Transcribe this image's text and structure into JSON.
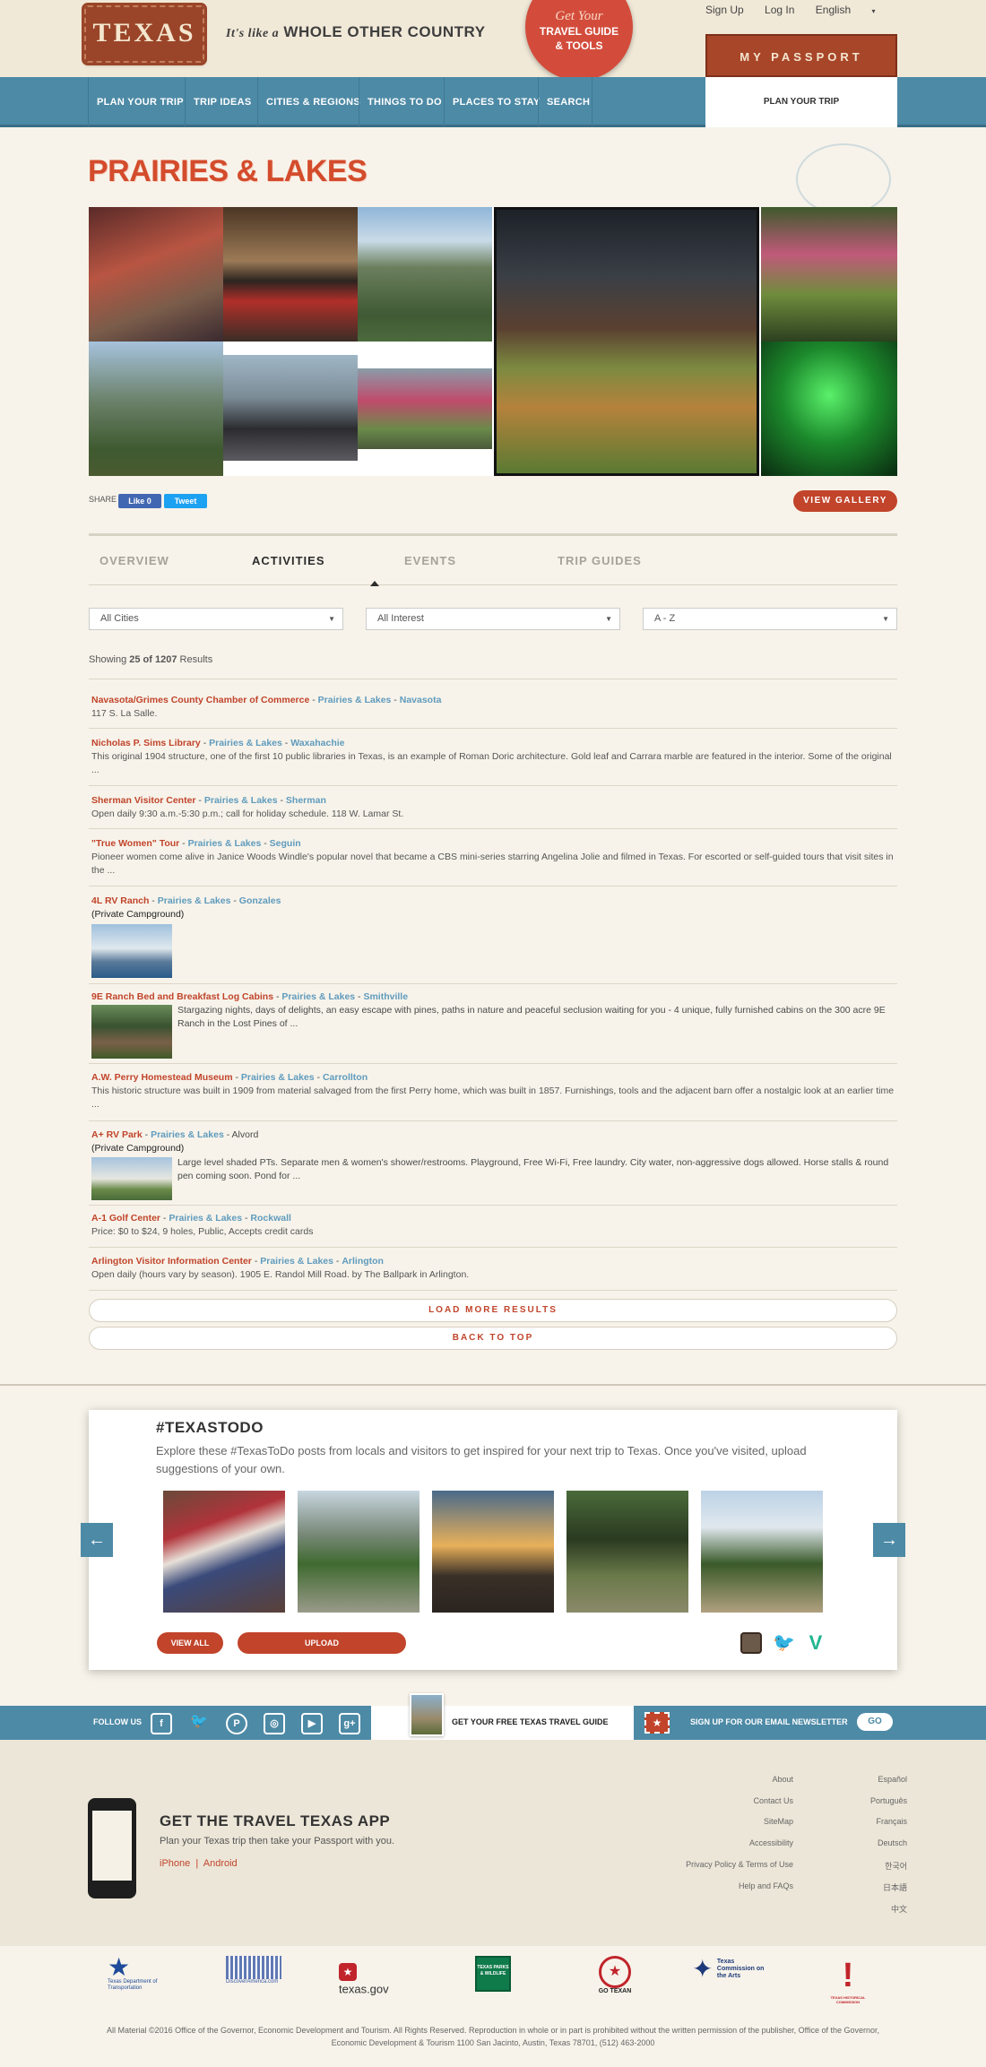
{
  "header": {
    "logo_text": "TEXAS",
    "tagline_italic": "It's like a",
    "tagline_main": "WHOLE OTHER COUNTRY",
    "seal_line1": "Get Your",
    "seal_line2": "TRAVEL GUIDE",
    "seal_line3": "& TOOLS",
    "sign_up": "Sign Up",
    "log_in": "Log In",
    "language": "English",
    "passport": "MY PASSPORT"
  },
  "nav": {
    "items": [
      "PLAN YOUR TRIP",
      "TRIP IDEAS",
      "CITIES & REGIONS",
      "THINGS TO DO",
      "PLACES TO STAY",
      "SEARCH"
    ],
    "plan_tab": "PLAN YOUR TRIP"
  },
  "page": {
    "title": "PRAIRIES & LAKES",
    "share_label": "SHARE",
    "like_label": "Like 0",
    "tweet_label": "Tweet",
    "view_gallery": "VIEW GALLERY"
  },
  "tabs": [
    "OVERVIEW",
    "ACTIVITIES",
    "EVENTS",
    "TRIP GUIDES"
  ],
  "filters": {
    "cities": "All Cities",
    "interest": "All Interest",
    "sort": "A - Z"
  },
  "results_summary": {
    "prefix": "Showing",
    "count": "25 of 1207",
    "suffix": "Results"
  },
  "results": [
    {
      "title": "Navasota/Grimes County Chamber of Commerce",
      "region": "Prairies & Lakes",
      "city": "Navasota",
      "tag": "",
      "desc": "117 S. La Salle."
    },
    {
      "title": "Nicholas P. Sims Library",
      "region": "Prairies & Lakes",
      "city": "Waxahachie",
      "tag": "",
      "desc": "This original 1904 structure, one of the first 10 public libraries in Texas, is an example of Roman Doric architecture. Gold leaf and Carrara marble are featured in the interior. Some of the original ..."
    },
    {
      "title": "Sherman Visitor Center",
      "region": "Prairies & Lakes",
      "city": "Sherman",
      "tag": "",
      "desc": "Open daily 9:30 a.m.-5:30 p.m.; call for holiday schedule. 118 W. Lamar St."
    },
    {
      "title": "\"True Women\" Tour",
      "region": "Prairies & Lakes",
      "city": "Seguin",
      "tag": "",
      "desc": "Pioneer women come alive in Janice Woods Windle's popular novel that became a CBS mini-series starring Angelina Jolie and filmed in Texas. For escorted or self-guided tours that visit sites in the ..."
    },
    {
      "title": "4L RV Ranch",
      "region": "Prairies & Lakes",
      "city": "Gonzales",
      "tag": "(Private Campground)",
      "desc": ""
    },
    {
      "title": "9E Ranch Bed and Breakfast Log Cabins",
      "region": "Prairies & Lakes",
      "city": "Smithville",
      "tag": "",
      "desc": "Stargazing nights, days of delights, an easy escape with pines, paths in nature and peaceful seclusion waiting for you - 4 unique, fully furnished cabins on the 300 acre 9E Ranch in the Lost Pines of ..."
    },
    {
      "title": "A.W. Perry Homestead Museum",
      "region": "Prairies & Lakes",
      "city": "Carrollton",
      "tag": "",
      "desc": "This historic structure was built in 1909 from material salvaged from the first Perry home, which was built in 1857. Furnishings, tools and the adjacent barn offer a nostalgic look at an earlier time ..."
    },
    {
      "title": "A+ RV Park",
      "region": "Prairies & Lakes",
      "city": "Alvord",
      "tag": "(Private Campground)",
      "desc": "Large level shaded PTs. Separate men & women's shower/restrooms. Playground, Free Wi-Fi, Free laundry. City water, non-aggressive dogs allowed. Horse stalls & round pen coming soon. Pond for ..."
    },
    {
      "title": "A-1 Golf Center",
      "region": "Prairies & Lakes",
      "city": "Rockwall",
      "tag": "",
      "desc": "Price: $0 to $24, 9 holes, Public, Accepts credit cards"
    },
    {
      "title": "Arlington Visitor Information Center",
      "region": "Prairies & Lakes",
      "city": "Arlington",
      "tag": "",
      "desc": "Open daily (hours vary by season). 1905 E. Randol Mill Road. by The Ballpark in Arlington."
    }
  ],
  "buttons": {
    "load_more": "LOAD MORE RESULTS",
    "back_to_top": "BACK TO TOP"
  },
  "todo": {
    "title": "#TEXASTODO",
    "text": "Explore these #TexasToDo posts from locals and visitors to get inspired for your next trip to Texas. Once you've visited, upload suggestions of your own.",
    "view_all": "VIEW ALL",
    "upload": "UPLOAD"
  },
  "band": {
    "follow_us": "FOLLOW US",
    "guide_text": "GET YOUR FREE TEXAS TRAVEL GUIDE",
    "newsletter": "SIGN UP FOR OUR EMAIL NEWSLETTER",
    "go": "GO"
  },
  "footer": {
    "app_title": "GET THE TRAVEL TEXAS APP",
    "app_sub": "Plan your Texas trip then take your Passport with you.",
    "iphone": "iPhone",
    "android": "Android",
    "links": [
      "About",
      "Contact Us",
      "SiteMap",
      "Accessibility",
      "Privacy Policy & Terms of Use",
      "Help and FAQs"
    ],
    "languages": [
      "Español",
      "Português",
      "Français",
      "Deutsch",
      "한국어",
      "日本語",
      "中文"
    ],
    "partners": [
      "Texas Department of Transportation",
      "DiscoverAmerica.com",
      "texas.gov",
      "TEXAS PARKS & WILDLIFE",
      "GO TEXAN",
      "Texas Commission on the Arts",
      "TEXAS HISTORICAL COMMISSION"
    ],
    "copyright": "All Material ©2016 Office of the Governor, Economic Development and Tourism. All Rights Reserved. Reproduction in whole or in part is prohibited without the written permission of the publisher, Office of the Governor, Economic Development & Tourism 1100 San Jacinto, Austin, Texas 78701, (512) 463-2000"
  },
  "colors": {
    "brand_red": "#c1442b",
    "nav_blue": "#4d8aa6",
    "link_blue": "#5f9bbd",
    "background": "#f7f3ea"
  }
}
